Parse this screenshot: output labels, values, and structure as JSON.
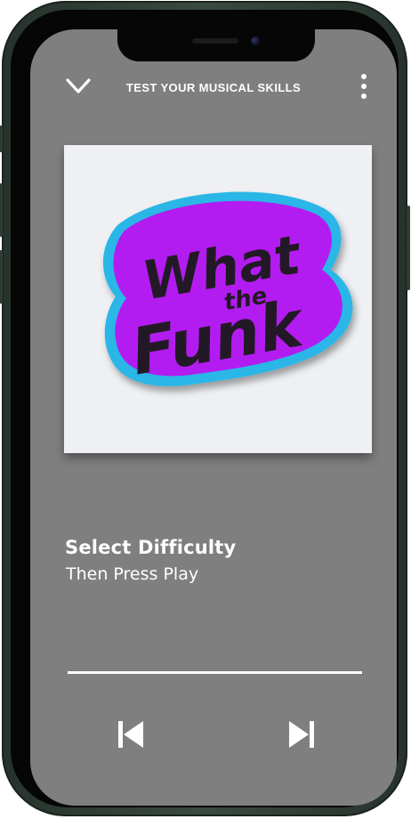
{
  "header": {
    "title": "TEST YOUR MUSICAL SKILLS",
    "collapse_icon": "chevron-down-icon",
    "menu_icon": "more-vertical-icon"
  },
  "artwork": {
    "logo_line1": "What",
    "logo_line2": "the",
    "logo_line3": "Funk",
    "colors": {
      "outline": "#29b6e6",
      "fill": "#b31df0",
      "ink": "#231926"
    }
  },
  "now_playing": {
    "title": "Select Difficulty",
    "subtitle": "Then Press Play"
  },
  "progress": {
    "value": 1.0
  },
  "controls": {
    "previous_icon": "skip-previous-icon",
    "next_icon": "skip-next-icon"
  },
  "colors": {
    "screen_bg": "#7f7f7f",
    "text": "#ffffff",
    "frame": "#2f3d35"
  }
}
